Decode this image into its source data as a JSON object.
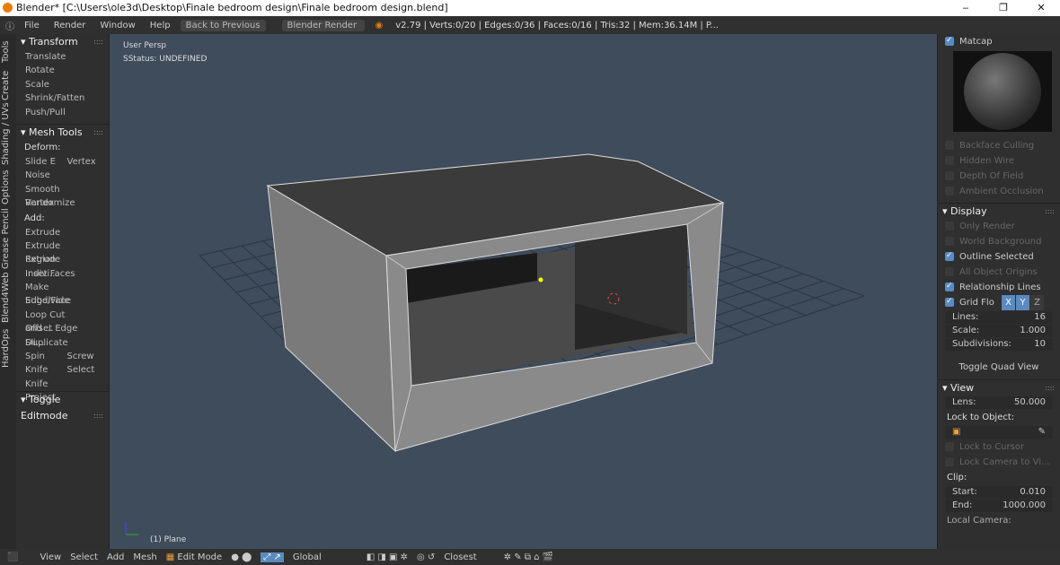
{
  "window": {
    "title": "Blender* [C:\\Users\\ole3d\\Desktop\\Finale bedroom design\\Finale bedroom design.blend]",
    "controls": [
      "‒",
      "❐",
      "✕"
    ]
  },
  "menubar": {
    "items": [
      "File",
      "Render",
      "Window",
      "Help"
    ],
    "back": "Back to Previous",
    "engine": "Blender Render",
    "stats": "v2.79 | Verts:0/20 | Edges:0/36 | Faces:0/16 | Tris:32 | Mem:36.14M | P..."
  },
  "left_tabs": [
    "Tools",
    "Create",
    "Shading / UVs",
    "Options",
    "Grease Pencil",
    "Blend4Web",
    "HardOps"
  ],
  "toolshelf": {
    "transform": {
      "title": "Transform",
      "items": [
        "Translate",
        "Rotate",
        "Scale",
        "Shrink/Fatten",
        "Push/Pull"
      ]
    },
    "mesh_tools": {
      "title": "Mesh Tools",
      "deform_label": "Deform:",
      "deform": [
        [
          "Slide E",
          "Vertex"
        ],
        [
          "Noise"
        ],
        [
          "Smooth Vertex"
        ],
        [
          "Randomize"
        ]
      ],
      "add_label": "Add:",
      "add": [
        [
          "Extrude"
        ],
        [
          "Extrude Region"
        ],
        [
          "Extrude Indivi..."
        ],
        [
          "Inset Faces"
        ],
        [
          "Make Edge/Face"
        ],
        [
          "Subdivide"
        ],
        [
          "Loop Cut and ..."
        ],
        [
          "Offset Edge Sli..."
        ],
        [
          "Duplicate"
        ],
        [
          "Spin",
          "Screw"
        ],
        [
          "Knife",
          "Select"
        ],
        [
          "Knife Project"
        ]
      ]
    },
    "toggle_editmode": "Toggle Editmode"
  },
  "viewport": {
    "view_name": "User Persp",
    "status": "SStatus: UNDEFINED",
    "object": "(1) Plane"
  },
  "right_panel": {
    "matcap": "Matcap",
    "shading_opts": [
      {
        "label": "Backface Culling",
        "checked": false
      },
      {
        "label": "Hidden Wire",
        "checked": false
      },
      {
        "label": "Depth Of Field",
        "checked": false
      },
      {
        "label": "Ambient Occlusion",
        "checked": false
      }
    ],
    "display": {
      "title": "Display",
      "opts": [
        {
          "label": "Only Render",
          "checked": false
        },
        {
          "label": "World Background",
          "checked": false
        },
        {
          "label": "Outline Selected",
          "checked": true
        },
        {
          "label": "All Object Origins",
          "checked": false
        },
        {
          "label": "Relationship Lines",
          "checked": true
        }
      ],
      "grid_floor": "Grid Flo",
      "axes": [
        "X",
        "Y",
        "Z"
      ],
      "lines_label": "Lines:",
      "lines": "16",
      "scale_label": "Scale:",
      "scale": "1.000",
      "subdiv_label": "Subdivisions:",
      "subdiv": "10",
      "quad": "Toggle Quad View"
    },
    "view": {
      "title": "View",
      "lens_label": "Lens:",
      "lens": "50.000",
      "lock_obj": "Lock to Object:",
      "lock_cursor": "Lock to Cursor",
      "lock_camera": "Lock Camera to Vi...",
      "clip": "Clip:",
      "start_label": "Start:",
      "start": "0.010",
      "end_label": "End:",
      "end": "1000.000",
      "local_camera": "Local Camera:"
    }
  },
  "footer": {
    "items": [
      "View",
      "Select",
      "Add",
      "Mesh"
    ],
    "mode": "Edit Mode",
    "orientation": "Global",
    "snap": "Closest"
  }
}
